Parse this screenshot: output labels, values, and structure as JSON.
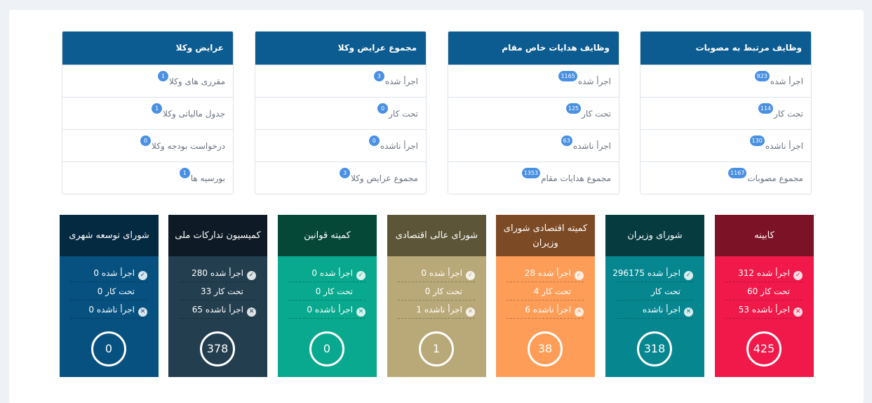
{
  "list_cards": [
    {
      "title": "وظایف مرتبط به مصوبات",
      "rows": [
        {
          "label": "اجرأ شده",
          "count": "923"
        },
        {
          "label": "تحت کار",
          "count": "114"
        },
        {
          "label": "اجرأ ناشده",
          "count": "130"
        },
        {
          "label": "مجموع مصوبات",
          "count": "1167"
        }
      ]
    },
    {
      "title": "وظایف هدایات خاص مقام",
      "rows": [
        {
          "label": "اجرأ شده",
          "count": "1165"
        },
        {
          "label": "تحت کار",
          "count": "125"
        },
        {
          "label": "اجرأ ناشده",
          "count": "63"
        },
        {
          "label": "مجموع هدایات مقام",
          "count": "1353"
        }
      ]
    },
    {
      "title": "مجموع عرایض وکلا",
      "rows": [
        {
          "label": "اجرأ شده",
          "count": "3"
        },
        {
          "label": "تحت کار",
          "count": "0"
        },
        {
          "label": "اجرأ ناشده",
          "count": "0"
        },
        {
          "label": "مجموع عرایض وکلا",
          "count": "3"
        }
      ]
    },
    {
      "title": "عرایض وکلا",
      "rows": [
        {
          "label": "مقرری های وکلا",
          "count": "1"
        },
        {
          "label": "جدول مالیاتی وکلا",
          "count": "1"
        },
        {
          "label": "درخواست بودجه وکلا",
          "count": "0"
        },
        {
          "label": "بورسیه ها",
          "count": "1"
        }
      ]
    }
  ],
  "tiles": [
    {
      "title": "کابینه",
      "done": "اجرأ شده 312",
      "in_progress": "تحت کار 60",
      "not_done": "اجرأ ناشده 53",
      "total": "425",
      "head_color": "#7c1225",
      "body_color": "#f0194a"
    },
    {
      "title": "شورای وزیران",
      "done": "اجرأ شده 296175",
      "in_progress": "تحت کار",
      "not_done": "اجرأ ناشده",
      "total": "318",
      "head_color": "#063c40",
      "body_color": "#068790"
    },
    {
      "title": "کمیته اقتصادی شورای وزیران",
      "done": "اجرأ شده 28",
      "in_progress": "تحت کار 4",
      "not_done": "اجرأ ناشده 6",
      "total": "38",
      "head_color": "#7c4a25",
      "body_color": "#fe9d58"
    },
    {
      "title": "شورای عالی اقتصادی",
      "done": "اجرأ شده 0",
      "in_progress": "تحت کار 0",
      "not_done": "اجرأ ناشده 1",
      "total": "1",
      "head_color": "#5c5538",
      "body_color": "#b9a978"
    },
    {
      "title": "کمیته قوانین",
      "done": "اجرأ شده 0",
      "in_progress": "تحت کار 0",
      "not_done": "اجرأ ناشده 0",
      "total": "0",
      "head_color": "#054838",
      "body_color": "#08a98e"
    },
    {
      "title": "کمیسیون تدارکات ملی",
      "done": "اجرأ شده 280",
      "in_progress": "تحت کار 33",
      "not_done": "اجرأ ناشده 65",
      "total": "378",
      "head_color": "#0e1b26",
      "body_color": "#233e4e"
    },
    {
      "title": "شورای توسعه شهری",
      "done": "اجرأ شده 0",
      "in_progress": "تحت کار 0",
      "not_done": "اجرأ ناشده 0",
      "total": "0",
      "head_color": "#042a42",
      "body_color": "#06517f"
    }
  ],
  "icons": {
    "check": "check-circle-icon",
    "cross": "x-circle-icon"
  }
}
